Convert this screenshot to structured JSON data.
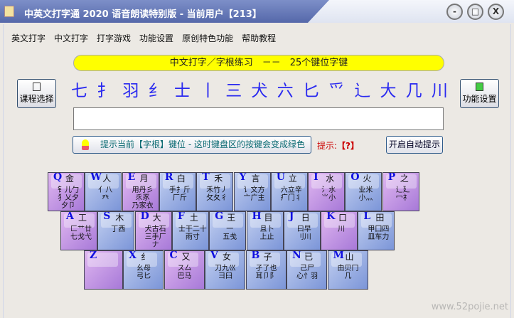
{
  "window": {
    "title": "中英文打字通 2020 语音朗读特别版 - 当前用户【213】",
    "minimize": "-",
    "maximize": "□",
    "close": "X"
  },
  "menu": [
    "英文打字",
    "中文打字",
    "打字游戏",
    "功能设置",
    "原创特色功能",
    "帮助教程"
  ],
  "banner": "中文打字／字根练习　－－　25个键位字键",
  "radicals": [
    "七",
    "扌",
    "羽",
    "纟",
    "士",
    "丨",
    "三",
    "犬",
    "六",
    "匕",
    "爫",
    "辶",
    "大",
    "几",
    "川"
  ],
  "buttons": {
    "course": "课程选择",
    "settings": "功能设置",
    "hint_button": "提示当前【字根】键位 - 这时键盘区的按键会变成绿色",
    "auto_hint": "开启自动提示"
  },
  "hint": {
    "label": "提示:",
    "value": "【?】"
  },
  "input": {
    "value": ""
  },
  "keyboard": [
    [
      {
        "k": "Q",
        "m": "金",
        "s": "钅儿勹\n犭乂夕\n夕卩",
        "c": "purple"
      },
      {
        "k": "W",
        "m": "人",
        "s": "亻八\n癶",
        "c": "blue"
      },
      {
        "k": "E",
        "m": "月",
        "s": "用丹彡\n乑豕\n乃家衣",
        "c": "purple"
      },
      {
        "k": "R",
        "m": "白",
        "s": "手扌斤\n厂斤",
        "c": "blue"
      },
      {
        "k": "T",
        "m": "禾",
        "s": "禾竹丿\n攵夂彳",
        "c": "blue"
      },
      {
        "k": "Y",
        "m": "言",
        "s": "讠文方\n亠广主",
        "c": "blue"
      },
      {
        "k": "U",
        "m": "立",
        "s": "六立辛\n疒门丬",
        "c": "blue"
      },
      {
        "k": "I",
        "m": "水",
        "s": "氵水\n⺌小",
        "c": "purple"
      },
      {
        "k": "O",
        "m": "火",
        "s": "业米\n小灬",
        "c": "blue"
      },
      {
        "k": "P",
        "m": "之",
        "s": "辶廴\n冖礻",
        "c": "purple"
      }
    ],
    [
      {
        "k": "A",
        "m": "工",
        "s": "匚艹廿\n七戈弋",
        "c": "purple"
      },
      {
        "k": "S",
        "m": "木",
        "s": "丁西",
        "c": "blue"
      },
      {
        "k": "D",
        "m": "大",
        "s": "犬古石\n三手厂\nナ",
        "c": "purple"
      },
      {
        "k": "F",
        "m": "土",
        "s": "士干二十\n雨寸",
        "c": "blue"
      },
      {
        "k": "G",
        "m": "王",
        "s": "一\n五戋",
        "c": "blue"
      },
      {
        "k": "H",
        "m": "目",
        "s": "且卜\n上止",
        "c": "blue"
      },
      {
        "k": "J",
        "m": "日",
        "s": "曰早\n刂川",
        "c": "blue"
      },
      {
        "k": "K",
        "m": "口",
        "s": "川",
        "c": "purple"
      },
      {
        "k": "L",
        "m": "田",
        "s": "甲囗四\n皿车力",
        "c": "blue"
      }
    ],
    [
      {
        "k": "Z",
        "m": "",
        "s": "",
        "c": "purple"
      },
      {
        "k": "X",
        "m": "纟",
        "s": "幺母\n弓匕",
        "c": "blue"
      },
      {
        "k": "C",
        "m": "又",
        "s": "ス厶\n巴马",
        "c": "purple"
      },
      {
        "k": "V",
        "m": "女",
        "s": "刀九巛\n彐臼",
        "c": "blue"
      },
      {
        "k": "B",
        "m": "子",
        "s": "孑了也\n耳卩阝",
        "c": "blue"
      },
      {
        "k": "N",
        "m": "已",
        "s": "己尸\n心忄羽",
        "c": "blue"
      },
      {
        "k": "M",
        "m": "山",
        "s": "由贝冂\n几",
        "c": "blue"
      }
    ]
  ],
  "watermark": "www.52pojie.net"
}
